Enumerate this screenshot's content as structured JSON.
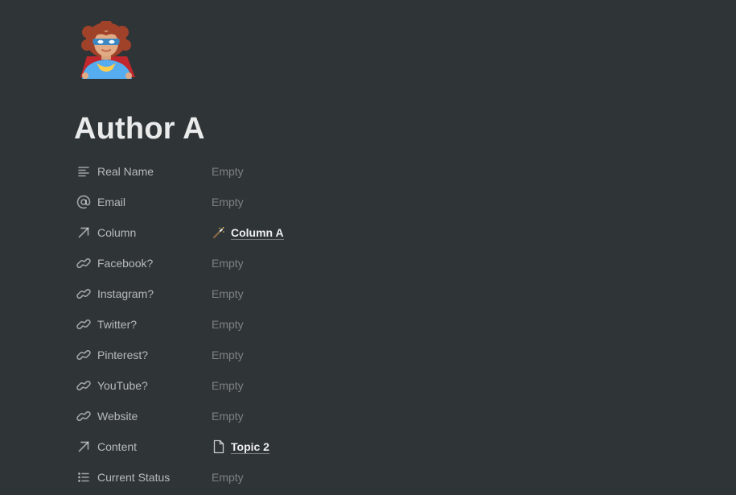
{
  "page": {
    "icon": "superhero-woman-emoji",
    "title": "Author A"
  },
  "properties": [
    {
      "name": "Real Name",
      "icon": "text-lines-icon",
      "value": "Empty"
    },
    {
      "name": "Email",
      "icon": "at-sign-icon",
      "value": "Empty"
    },
    {
      "name": "Column",
      "icon": "relation-arrow-icon",
      "value": "Column A",
      "value_icon": "magic-wand-icon"
    },
    {
      "name": "Facebook?",
      "icon": "url-link-icon",
      "value": "Empty"
    },
    {
      "name": "Instagram?",
      "icon": "url-link-icon",
      "value": "Empty"
    },
    {
      "name": "Twitter?",
      "icon": "url-link-icon",
      "value": "Empty"
    },
    {
      "name": "Pinterest?",
      "icon": "url-link-icon",
      "value": "Empty"
    },
    {
      "name": "YouTube?",
      "icon": "url-link-icon",
      "value": "Empty"
    },
    {
      "name": "Website",
      "icon": "url-link-icon",
      "value": "Empty"
    },
    {
      "name": "Content",
      "icon": "relation-arrow-icon",
      "value": "Topic 2",
      "value_icon": "page-document-icon"
    },
    {
      "name": "Current Status",
      "icon": "bulleted-list-icon",
      "value": "Empty"
    }
  ]
}
